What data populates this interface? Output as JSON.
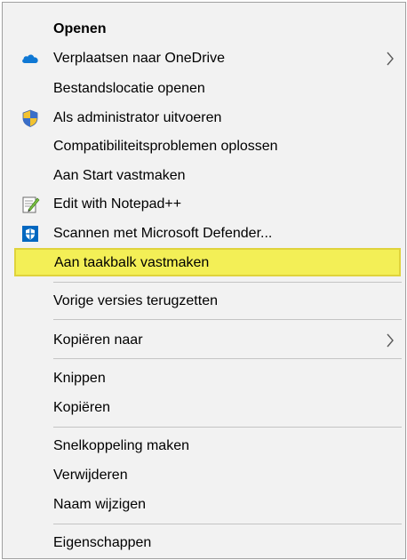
{
  "menu": {
    "items": [
      {
        "label": "Openen"
      },
      {
        "label": "Verplaatsen naar OneDrive",
        "icon": "onedrive-cloud-icon",
        "submenu": true
      },
      {
        "label": "Bestandslocatie openen"
      },
      {
        "label": "Als administrator uitvoeren",
        "icon": "uac-shield-icon"
      },
      {
        "label": "Compatibiliteitsproblemen oplossen"
      },
      {
        "label": "Aan Start vastmaken"
      },
      {
        "label": "Edit with Notepad++",
        "icon": "notepad-plus-plus-icon"
      },
      {
        "label": "Scannen met Microsoft Defender...",
        "icon": "defender-shield-icon"
      },
      {
        "label": "Aan taakbalk vastmaken",
        "highlighted": true
      },
      {
        "label": "Vorige versies terugzetten"
      },
      {
        "label": "Kopiëren naar",
        "submenu": true
      },
      {
        "label": "Knippen"
      },
      {
        "label": "Kopiëren"
      },
      {
        "label": "Snelkoppeling maken"
      },
      {
        "label": "Verwijderen"
      },
      {
        "label": "Naam wijzigen"
      },
      {
        "label": "Eigenschappen"
      }
    ]
  },
  "colors": {
    "menu_background": "#f2f2f2",
    "highlight_fill": "#f3ef56",
    "highlight_border": "#dfd33c",
    "separator": "#c4c4c4",
    "onedrive_blue": "#0f78d4",
    "defender_blue": "#0067c0"
  }
}
